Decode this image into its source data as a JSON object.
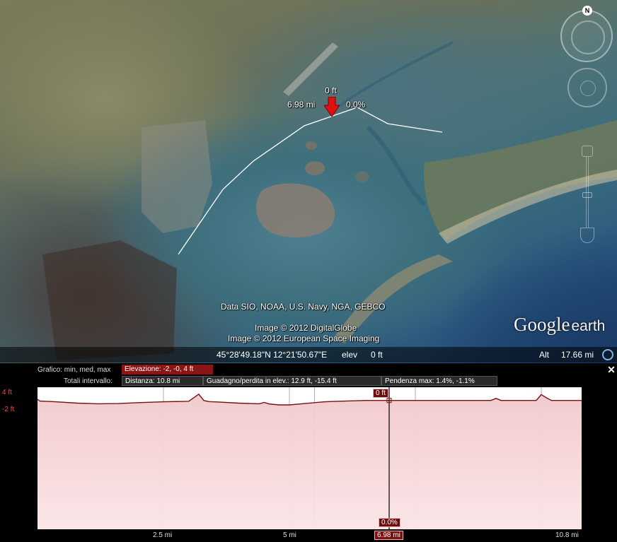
{
  "map": {
    "path_marker": {
      "elevation": "0 ft",
      "distance": "6.98 mi",
      "slope": "0.0%"
    },
    "credits": [
      "Data SIO, NOAA, U.S. Navy, NGA, GEBCO",
      "Image © 2012 DigitalGlobe",
      "Image © 2012 European Space Imaging"
    ],
    "logo": {
      "google": "Google",
      "earth": "earth"
    },
    "compass_north": "N"
  },
  "status_bar": {
    "coordinates": "45°28'49.18\"N  12°21'50.67\"E",
    "elev_label": "elev",
    "elev_value": "0 ft",
    "alt_label": "Alt",
    "alt_value": "17.66 mi"
  },
  "profile": {
    "graph_label": "Grafico: min, med, max",
    "elevation_summary": "Elevazione: -2, -0, 4 ft",
    "totals_label": "Totali intervallo:",
    "distance_summary": "Distanza: 10.8 mi",
    "gain_loss_summary": "Guadagno/perdita in elev.: 12.9 ft, -15.4 ft",
    "slope_summary": "Pendenza max: 1.4%, -1.1%",
    "close_label": "✕",
    "y_tick_labels": [
      "4 ft",
      "-2 ft"
    ],
    "x_tick_labels": [
      "2.5 mi",
      "5 mi",
      "10.8 mi"
    ],
    "cursor": {
      "distance": "6.98 mi",
      "elevation": "0 ft",
      "slope": "0.0%"
    }
  },
  "chart_data": {
    "type": "area",
    "title": "",
    "xlabel": "",
    "ylabel": "",
    "x_unit": "mi",
    "y_unit": "ft",
    "xlim": [
      0,
      10.8
    ],
    "ylim": [
      -2,
      4
    ],
    "x_ticks": [
      2.5,
      5,
      10.8
    ],
    "y_ticks": [
      4,
      -2
    ],
    "grid": true,
    "series": [
      {
        "x": [
          0,
          0.05,
          0.3,
          0.8,
          1.2,
          1.6,
          2.0,
          2.5,
          3.0,
          3.2,
          3.3,
          3.4,
          3.6,
          4.0,
          4.4,
          4.5,
          4.6,
          4.8,
          5.0,
          5.3,
          5.7,
          6.1,
          6.5,
          6.98,
          7.5,
          8.0,
          8.6,
          9.0,
          9.1,
          9.2,
          9.6,
          9.9,
          10.0,
          10.1,
          10.2,
          10.8
        ],
        "y": [
          0.5,
          -0.3,
          -0.5,
          -1.2,
          -1.5,
          -1.4,
          -1.0,
          -0.6,
          -0.4,
          2.8,
          0.0,
          -0.5,
          -0.7,
          -1.2,
          -1.5,
          -0.9,
          -1.6,
          -2.0,
          -2.0,
          -1.4,
          -0.6,
          -0.3,
          0.0,
          0.0,
          0.0,
          0.0,
          0.0,
          0.0,
          0.9,
          0.0,
          0.0,
          0.0,
          2.6,
          1.2,
          0.0,
          0.0
        ]
      }
    ],
    "cursor_x": 6.98,
    "colors": {
      "fill_top": "#f1c9cb",
      "fill_bottom": "#fbe4e6",
      "line": "#7a1010",
      "grid": "#9a9a9a"
    }
  }
}
